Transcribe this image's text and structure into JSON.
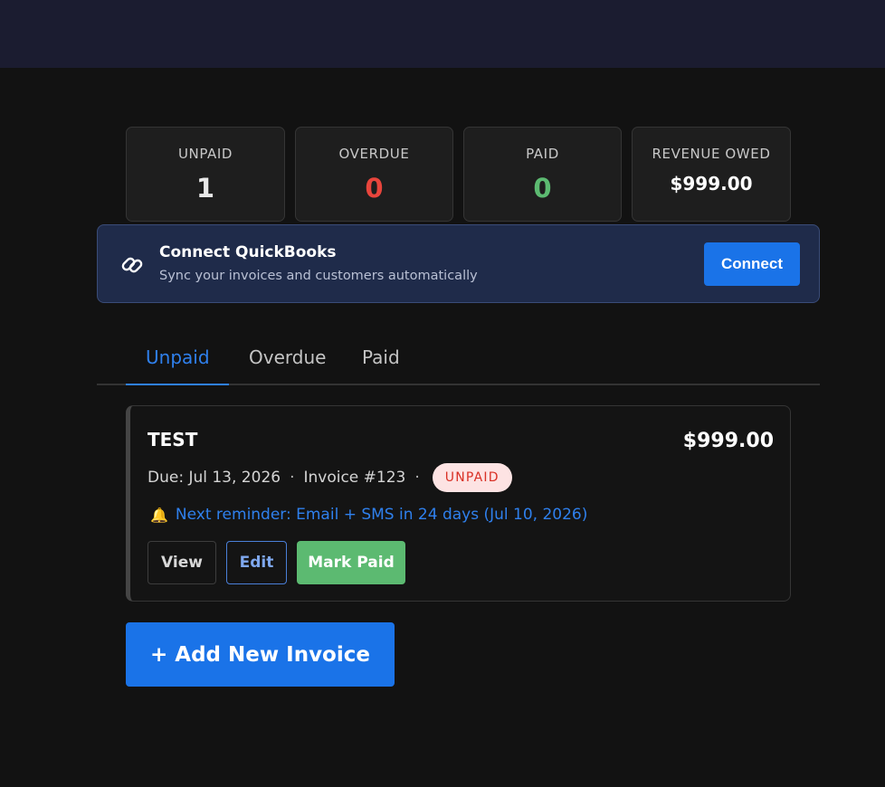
{
  "stats": [
    {
      "label": "UNPAID",
      "value": "1",
      "color": "#e8e8e8"
    },
    {
      "label": "OVERDUE",
      "value": "0",
      "color": "#e8453c"
    },
    {
      "label": "PAID",
      "value": "0",
      "color": "#5cba71"
    },
    {
      "label": "REVENUE OWED",
      "value": "$999.00",
      "color": "#ffffff"
    }
  ],
  "quickbooks": {
    "icon": "link-icon",
    "title": "Connect QuickBooks",
    "subtitle": "Sync your invoices and customers automatically",
    "button_label": "Connect"
  },
  "tabs": [
    {
      "label": "Unpaid",
      "active": true
    },
    {
      "label": "Overdue",
      "active": false
    },
    {
      "label": "Paid",
      "active": false
    }
  ],
  "invoice": {
    "title": "TEST",
    "amount": "$999.00",
    "due": "Due: Jul 13, 2026",
    "separator": "·",
    "number": "Invoice #123",
    "status": "UNPAID",
    "reminder_icon": "bell-icon",
    "reminder": "Next reminder: Email + SMS in 24 days (Jul 10, 2026)",
    "actions": {
      "view": "View",
      "edit": "Edit",
      "mark_paid": "Mark Paid"
    }
  },
  "add_invoice_label": "+ Add New Invoice"
}
